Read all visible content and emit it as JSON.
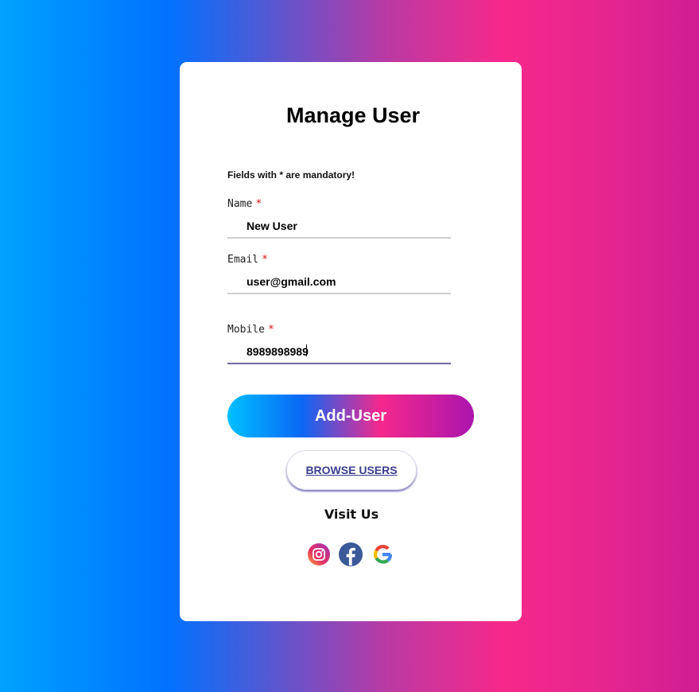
{
  "form": {
    "title": "Manage User",
    "mandatory_note": "Fields with * are mandatory!",
    "required_marker": "*",
    "fields": [
      {
        "label": "Name",
        "value": "New User"
      },
      {
        "label": "Email",
        "value": "user@gmail.com"
      },
      {
        "label": "Mobile",
        "value": "8989898989"
      }
    ],
    "add_button_label": "Add-User",
    "browse_button_label": "BROWSE USERS"
  },
  "social": {
    "heading": "Visit Us",
    "links": [
      {
        "icon": "instagram-icon"
      },
      {
        "icon": "facebook-icon"
      },
      {
        "icon": "google-icon"
      }
    ]
  },
  "colors": {
    "required": "#d0141c",
    "focus_underline": "#6f6a9e",
    "browse_text": "#3b3f8f"
  }
}
